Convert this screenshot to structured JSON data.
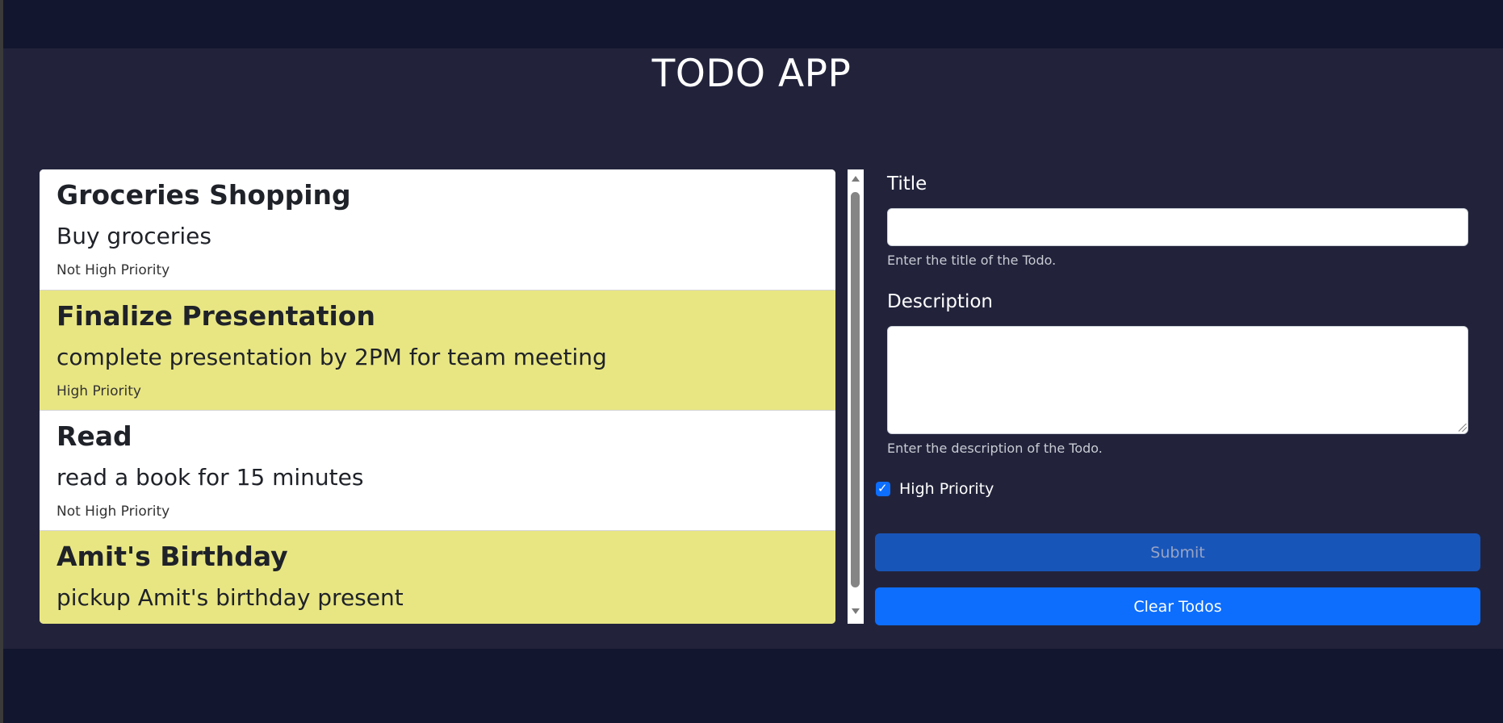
{
  "app": {
    "title": "TODO APP"
  },
  "todos": [
    {
      "title": "Groceries Shopping",
      "description": "Buy groceries",
      "priority_label": "Not High Priority",
      "high_priority": false
    },
    {
      "title": "Finalize Presentation",
      "description": "complete presentation by 2PM for team meeting",
      "priority_label": "High Priority",
      "high_priority": true
    },
    {
      "title": "Read",
      "description": "read a book for 15 minutes",
      "priority_label": "Not High Priority",
      "high_priority": false
    },
    {
      "title": "Amit's Birthday",
      "description": "pickup Amit's birthday present",
      "priority_label": "",
      "high_priority": true
    }
  ],
  "form": {
    "title_label": "Title",
    "title_value": "",
    "title_help": "Enter the title of the Todo.",
    "description_label": "Description",
    "description_value": "",
    "description_help": "Enter the description of the Todo.",
    "high_priority_label": "High Priority",
    "high_priority_checked": true,
    "submit_label": "Submit",
    "clear_label": "Clear Todos"
  },
  "colors": {
    "high_priority_bg": "#e8e683",
    "normal_bg": "#ffffff",
    "panel_bg": "#22233b",
    "page_bg": "#12162e",
    "accent": "#0d6efd"
  },
  "icons": {
    "checkbox": "check-icon",
    "scroll_up": "scroll-up-arrow-icon",
    "scroll_down": "scroll-down-arrow-icon"
  }
}
